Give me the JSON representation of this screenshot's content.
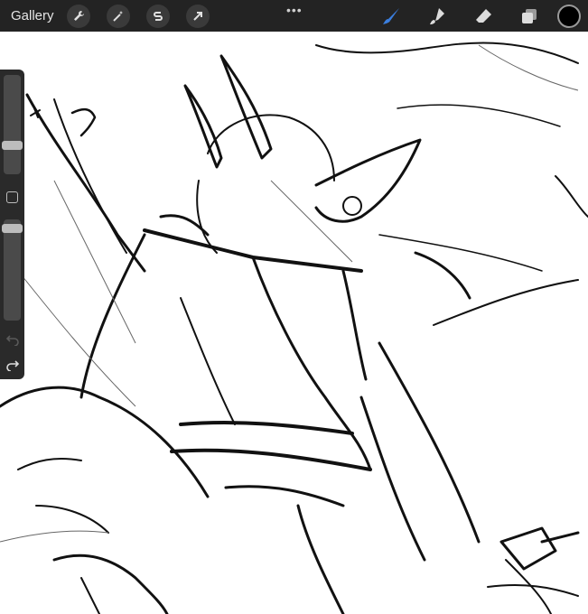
{
  "topbar": {
    "gallery_label": "Gallery",
    "menu_dots": "•••",
    "left_tools": [
      "wrench-icon",
      "magic-wand-icon",
      "selection-s-icon",
      "transform-arrow-icon"
    ],
    "right_tools": [
      "brush-icon",
      "smudge-icon",
      "eraser-icon",
      "layers-icon"
    ],
    "accent_color": "#3b7fe0",
    "current_color": "#000000"
  },
  "sidebar": {
    "brush_size_level": 0.6,
    "opacity_level": 0.0
  }
}
